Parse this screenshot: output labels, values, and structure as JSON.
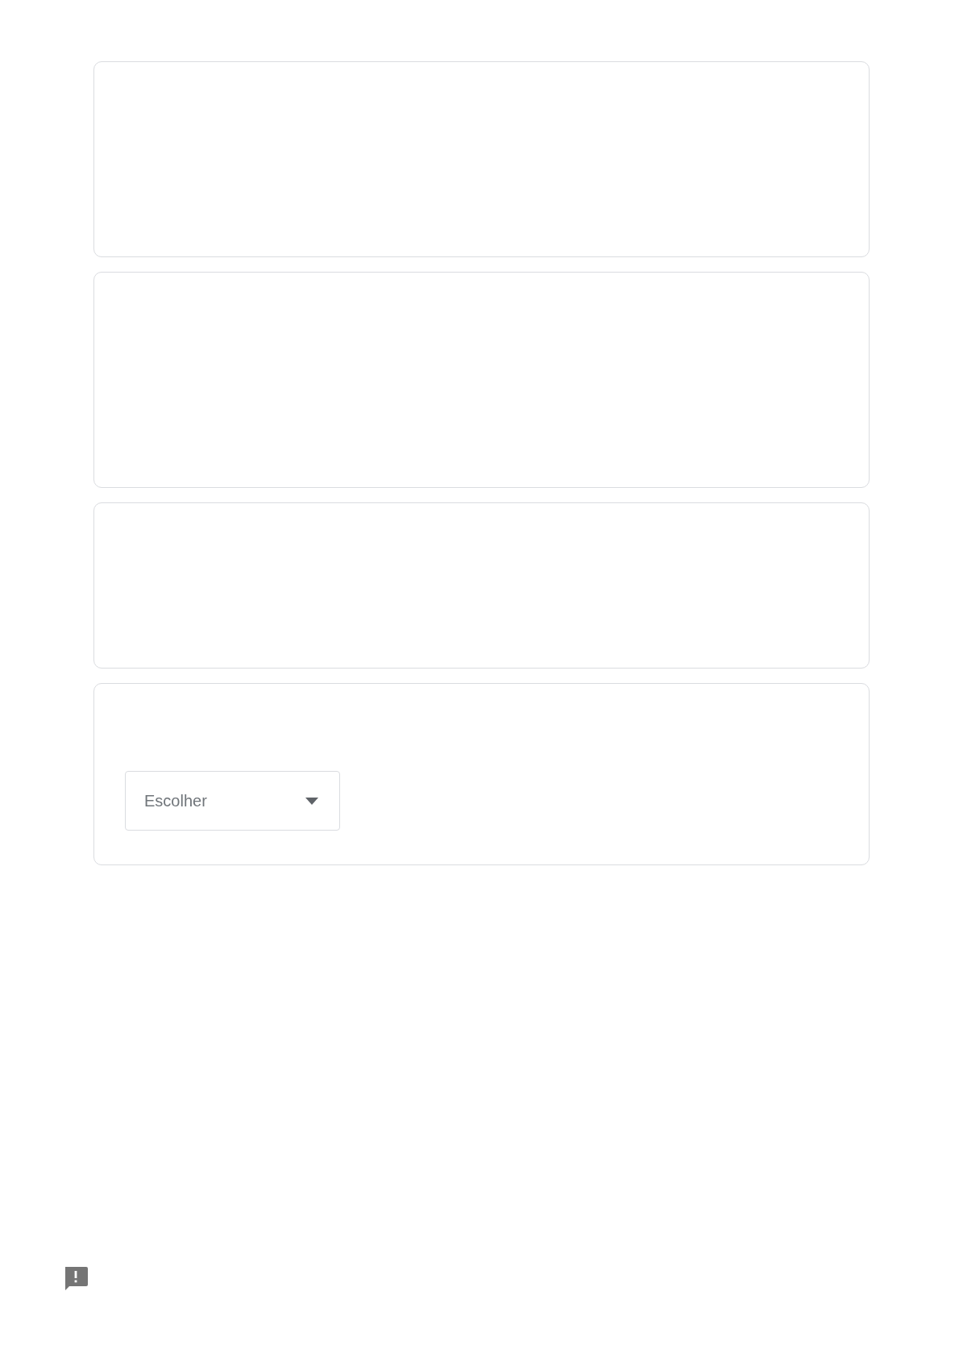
{
  "cards": [
    {
      "kind": "blank"
    },
    {
      "kind": "blank"
    },
    {
      "kind": "blank"
    },
    {
      "kind": "choice",
      "dropdown": {
        "placeholder": "Escolher"
      }
    }
  ],
  "feedback_button": {
    "kind": "report"
  }
}
